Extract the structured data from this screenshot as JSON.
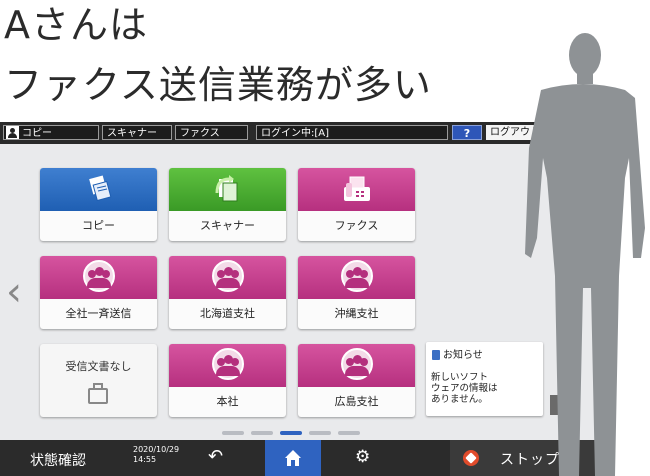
{
  "headline": {
    "line1": "Aさんは",
    "line2": "ファクス送信業務が多い"
  },
  "topbar": {
    "user_app": "コピー",
    "scanner": "スキャナー",
    "fax": "ファクス",
    "login_status": "ログイン中:[A]",
    "help": "?",
    "logout": "ログアウト"
  },
  "tiles": [
    {
      "label": "コピー",
      "color": "#2a6ac2",
      "icon": "copy-icon"
    },
    {
      "label": "スキャナー",
      "color": "#46a830",
      "icon": "scanner-icon"
    },
    {
      "label": "ファクス",
      "color": "#c13f8d",
      "icon": "fax-icon"
    },
    {
      "label": "全社一斉送信",
      "color": "#c13f8d",
      "icon": "group-icon"
    },
    {
      "label": "北海道支社",
      "color": "#c13f8d",
      "icon": "group-icon"
    },
    {
      "label": "沖縄支社",
      "color": "#c13f8d",
      "icon": "group-icon"
    },
    {
      "label": "受信文書なし",
      "icon": "fax-small-icon"
    },
    {
      "label": "本社",
      "color": "#c13f8d",
      "icon": "group-icon"
    },
    {
      "label": "広島支社",
      "color": "#c13f8d",
      "icon": "group-icon"
    }
  ],
  "notice": {
    "title": "お知らせ",
    "body_line1": "新しいソフト",
    "body_line2": "ウェアの情報は",
    "body_line3": "ありません。"
  },
  "bottombar": {
    "status": "状態確認",
    "date": "2020/10/29",
    "time": "14:55",
    "stop": "ストップ"
  },
  "pagination": {
    "pages": 5,
    "current": 3
  },
  "colors": {
    "accent": "#2f63c0",
    "stop": "#e04b2b"
  }
}
